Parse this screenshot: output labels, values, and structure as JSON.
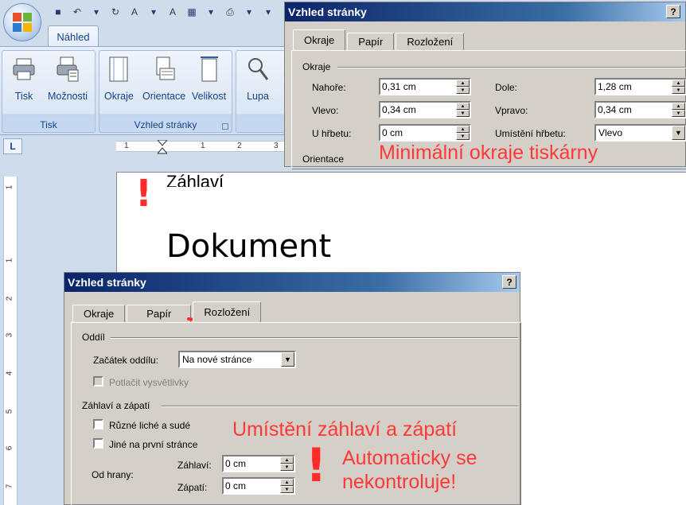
{
  "ribbon": {
    "tab": "Náhled",
    "groups": {
      "tisk": {
        "label": "Tisk",
        "buttons": [
          "Tisk",
          "Možnosti"
        ]
      },
      "vzhled": {
        "label": "Vzhled stránky",
        "buttons": [
          "Okraje",
          "Orientace",
          "Velikost"
        ]
      },
      "lupa": {
        "buttons": [
          "Lupa"
        ]
      }
    }
  },
  "ruler": {
    "h": [
      "1",
      "1",
      "2",
      "3"
    ],
    "v": [
      "1",
      "1",
      "2",
      "3",
      "4",
      "5",
      "6",
      "7"
    ]
  },
  "document": {
    "header_text": "Záhlaví",
    "title": "Dokument"
  },
  "dialog1": {
    "title": "Vzhled stránky",
    "tabs": [
      "Okraje",
      "Papír",
      "Rozložení"
    ],
    "section": "Okraje",
    "fields": {
      "nahore": {
        "label": "Nahoře:",
        "value": "0,31 cm"
      },
      "dole": {
        "label": "Dole:",
        "value": "1,28 cm"
      },
      "vlevo": {
        "label": "Vlevo:",
        "value": "0,34 cm"
      },
      "vpravo": {
        "label": "Vpravo:",
        "value": "0,34 cm"
      },
      "u_hrbetu": {
        "label": "U hřbetu:",
        "value": "0 cm"
      },
      "umisteni_hrbetu": {
        "label": "Umístění hřbetu:",
        "value": "Vlevo"
      }
    },
    "section2": "Orientace"
  },
  "dialog2": {
    "title": "Vzhled stránky",
    "tabs": [
      "Okraje",
      "Papír",
      "Rozložení"
    ],
    "section_oddil": "Oddíl",
    "zacatek_label": "Začátek oddílu:",
    "zacatek_value": "Na nové stránce",
    "potlacit": "Potlačit vysvětlivky",
    "section_hf": "Záhlaví a zápatí",
    "ruzne": "Různé liché a sudé",
    "jine": "Jiné na první stránce",
    "od_hrany": "Od hrany:",
    "zahlavi_label": "Záhlaví:",
    "zahlavi_value": "0 cm",
    "zapati_label": "Zápatí:",
    "zapati_value": "0 cm"
  },
  "annotations": {
    "min_margins": "Minimální okraje tiskárny",
    "placement": "Umístění záhlaví a zápatí",
    "auto_line1": "Automaticky se",
    "auto_line2": "nekontroluje!"
  },
  "colors": {
    "annotation": "#ff3838",
    "titlebar": "#0a246a"
  }
}
